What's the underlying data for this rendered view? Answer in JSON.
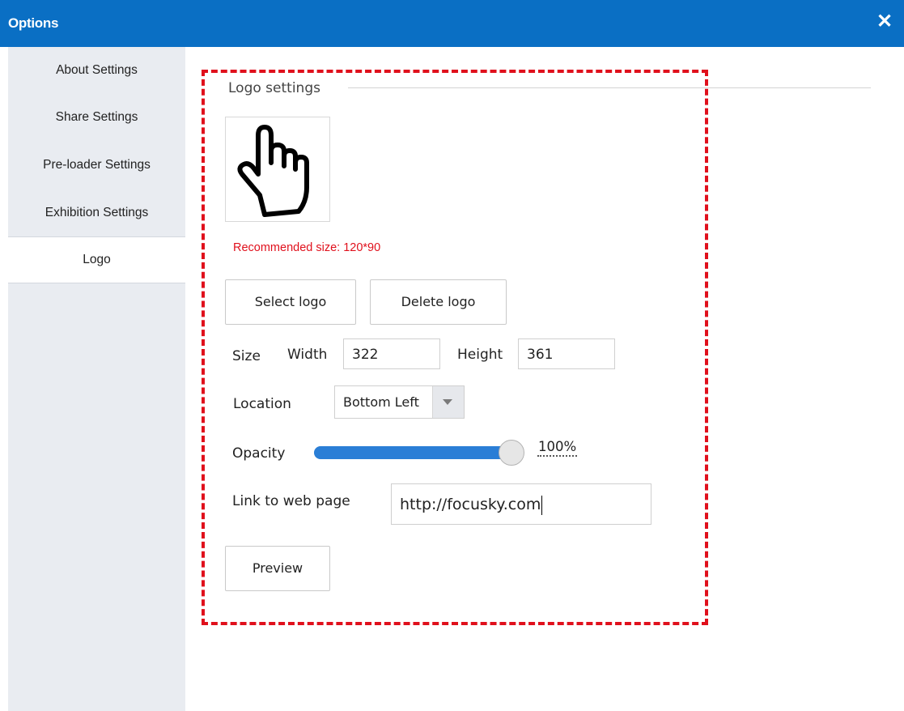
{
  "window": {
    "title": "Options",
    "close_label": "✕"
  },
  "sidebar": {
    "items": [
      {
        "label": "About Settings",
        "active": false
      },
      {
        "label": "Share Settings",
        "active": false
      },
      {
        "label": "Pre-loader Settings",
        "active": false
      },
      {
        "label": "Exhibition Settings",
        "active": false
      },
      {
        "label": "Logo",
        "active": true
      }
    ]
  },
  "logo_settings": {
    "section_title": "Logo settings",
    "preview_icon": "hand-pointer-icon",
    "recommended_size": "Recommended size: 120*90",
    "select_button": "Select logo",
    "delete_button": "Delete logo",
    "size_label": "Size",
    "width_label": "Width",
    "width_value": "322",
    "height_label": "Height",
    "height_value": "361",
    "location_label": "Location",
    "location_value": "Bottom Left",
    "opacity_label": "Opacity",
    "opacity_value": "100%",
    "opacity_fraction": 1.0,
    "link_label": "Link to web page",
    "link_value": "http://focusky.com",
    "preview_button": "Preview"
  },
  "colors": {
    "titlebar": "#0a6fc4",
    "highlight_dash": "#e0101c",
    "slider_fill": "#2a7ed6",
    "sidebar_bg": "#e9ecf1"
  }
}
